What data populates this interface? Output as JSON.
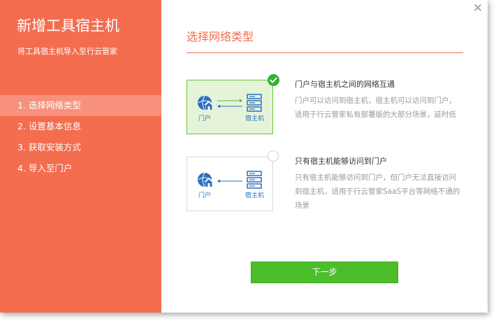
{
  "sidebar": {
    "title": "新增工具宿主机",
    "subtitle": "将工具宿主机导入至行云管家",
    "steps": [
      {
        "label": "1. 选择网络类型",
        "active": true
      },
      {
        "label": "2. 设置基本信息",
        "active": false
      },
      {
        "label": "3. 获取安装方式",
        "active": false
      },
      {
        "label": "4. 导入至门户",
        "active": false
      }
    ]
  },
  "main": {
    "section_title": "选择网络类型",
    "options": [
      {
        "selected": true,
        "portal_label": "门户",
        "host_label": "宿主机",
        "title": "门户与宿主机之间的网络互通",
        "description": "门户可以访问到宿主机，宿主机可以访问到门户，适用于行云管家私有部署版的大部分场景，延时低"
      },
      {
        "selected": false,
        "portal_label": "门户",
        "host_label": "宿主机",
        "title": "只有宿主机能够访问到门户",
        "description": "只有宿主机能够访问到门户，但门户无法直接访问到宿主机，适用于行云管家SaaS平台等网络不通的场景"
      }
    ],
    "next_label": "下一步"
  },
  "colors": {
    "accent": "#f46d4f",
    "primary_button": "#4cbd2b",
    "selected_card_bg": "#e5f4d8",
    "icon_blue": "#2a6fc0"
  },
  "icons": {
    "close": "close-icon",
    "portal": "house-globe-icon",
    "host": "server-icon",
    "selected": "check-circle-icon"
  }
}
